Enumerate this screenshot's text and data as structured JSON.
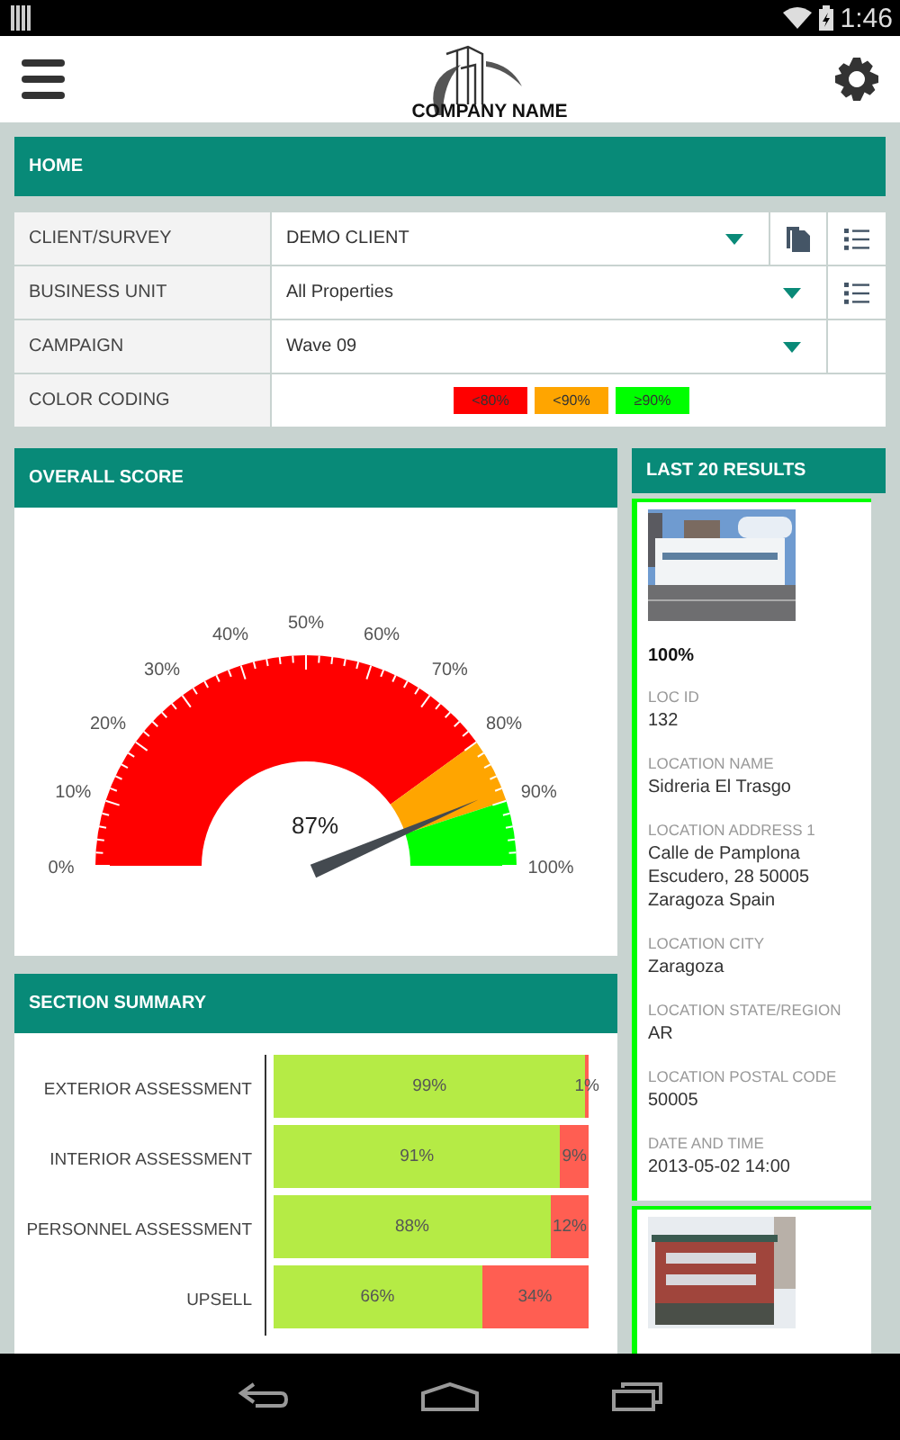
{
  "status_bar": {
    "time": "1:46"
  },
  "header": {
    "logo_text": "COMPANY NAME"
  },
  "home": {
    "title": "HOME"
  },
  "filters": [
    {
      "label": "CLIENT/SURVEY",
      "kind": "select",
      "value": "DEMO CLIENT",
      "actions": [
        {
          "kind": "copy"
        },
        {
          "kind": "list"
        }
      ]
    },
    {
      "label": "BUSINESS UNIT",
      "kind": "select",
      "value": "All Properties",
      "actions": [
        {
          "kind": "list"
        }
      ]
    },
    {
      "label": "CAMPAIGN",
      "kind": "select",
      "value": "Wave 09"
    },
    {
      "label": "COLOR CODING",
      "kind": "legend",
      "legend": [
        {
          "label": "<80%",
          "color": "#ff0000"
        },
        {
          "label": "<90%",
          "color": "#ffa500"
        },
        {
          "label": "≥90%",
          "color": "#00ff00"
        }
      ]
    }
  ],
  "overall_score": {
    "title": "OVERALL SCORE",
    "gauge": {
      "reading": "87%",
      "ticks": [
        "0%",
        "10%",
        "20%",
        "30%",
        "40%",
        "50%",
        "60%",
        "70%",
        "80%",
        "90%",
        "100%"
      ],
      "bands": [
        {
          "color": "#ff0000"
        },
        {
          "color": "#ffa500"
        },
        {
          "color": "#00ff00"
        }
      ]
    }
  },
  "section_summary": {
    "title": "SECTION SUMMARY",
    "chart_data": {
      "type": "bar",
      "orientation": "horizontal",
      "stacked": true,
      "categories": [
        "EXTERIOR ASSESSMENT",
        "INTERIOR ASSESSMENT",
        "PERSONNEL ASSESSMENT",
        "UPSELL"
      ],
      "series": [
        {
          "color": "#b5eb45",
          "values": [
            99,
            91,
            88,
            66
          ],
          "value_labels": [
            "99%",
            "91%",
            "88%",
            "66%"
          ]
        },
        {
          "color": "#ff5e52",
          "values": [
            1,
            9,
            12,
            34
          ],
          "value_labels": [
            "1%",
            "9%",
            "12%",
            "34%"
          ]
        }
      ]
    }
  },
  "last_results": {
    "title": "LAST 20 RESULTS",
    "results": [
      {
        "color": "#00ff00",
        "score": "100%",
        "fields": [
          {
            "label": "LOC ID",
            "value": "132"
          },
          {
            "label": "LOCATION NAME",
            "value": "Sidreria El Trasgo"
          },
          {
            "label": "LOCATION ADDRESS 1",
            "value": "Calle de Pamplona Escudero, 28 50005 Zaragoza Spain"
          },
          {
            "label": "LOCATION CITY",
            "value": "Zaragoza"
          },
          {
            "label": "LOCATION STATE/REGION",
            "value": "AR"
          },
          {
            "label": "LOCATION POSTAL CODE",
            "value": "50005"
          },
          {
            "label": "DATE AND TIME",
            "value": "2013-05-02 14:00"
          }
        ]
      },
      {
        "color": "#00ff00"
      }
    ]
  }
}
